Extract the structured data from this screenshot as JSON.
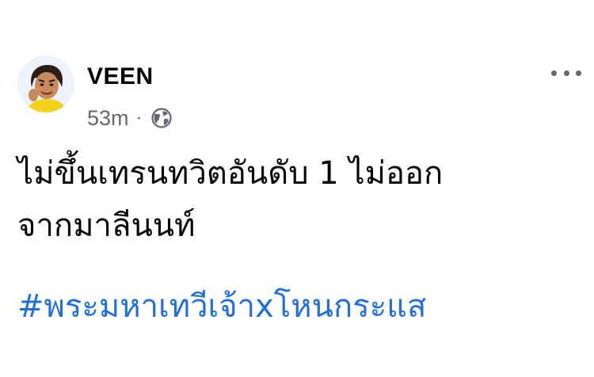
{
  "post": {
    "author": {
      "name": "VEEN",
      "avatar_icon": "profile-avatar-icon"
    },
    "meta": {
      "timestamp": "53m",
      "separator": "·",
      "audience_icon": "globe-public-icon"
    },
    "more_icon": "more-options-icon",
    "text_lines": [
      "ไม่ขึ้นเทรนทวิตอันดับ 1 ไม่ออก",
      "จากมาลีนนท์"
    ],
    "hashtag": "#พระมหาเทวีเจ้าxโหนกระแส"
  },
  "colors": {
    "background": "#ffffff",
    "text": "#050505",
    "secondary_text": "#65676b",
    "hashtag": "#216fdb"
  }
}
